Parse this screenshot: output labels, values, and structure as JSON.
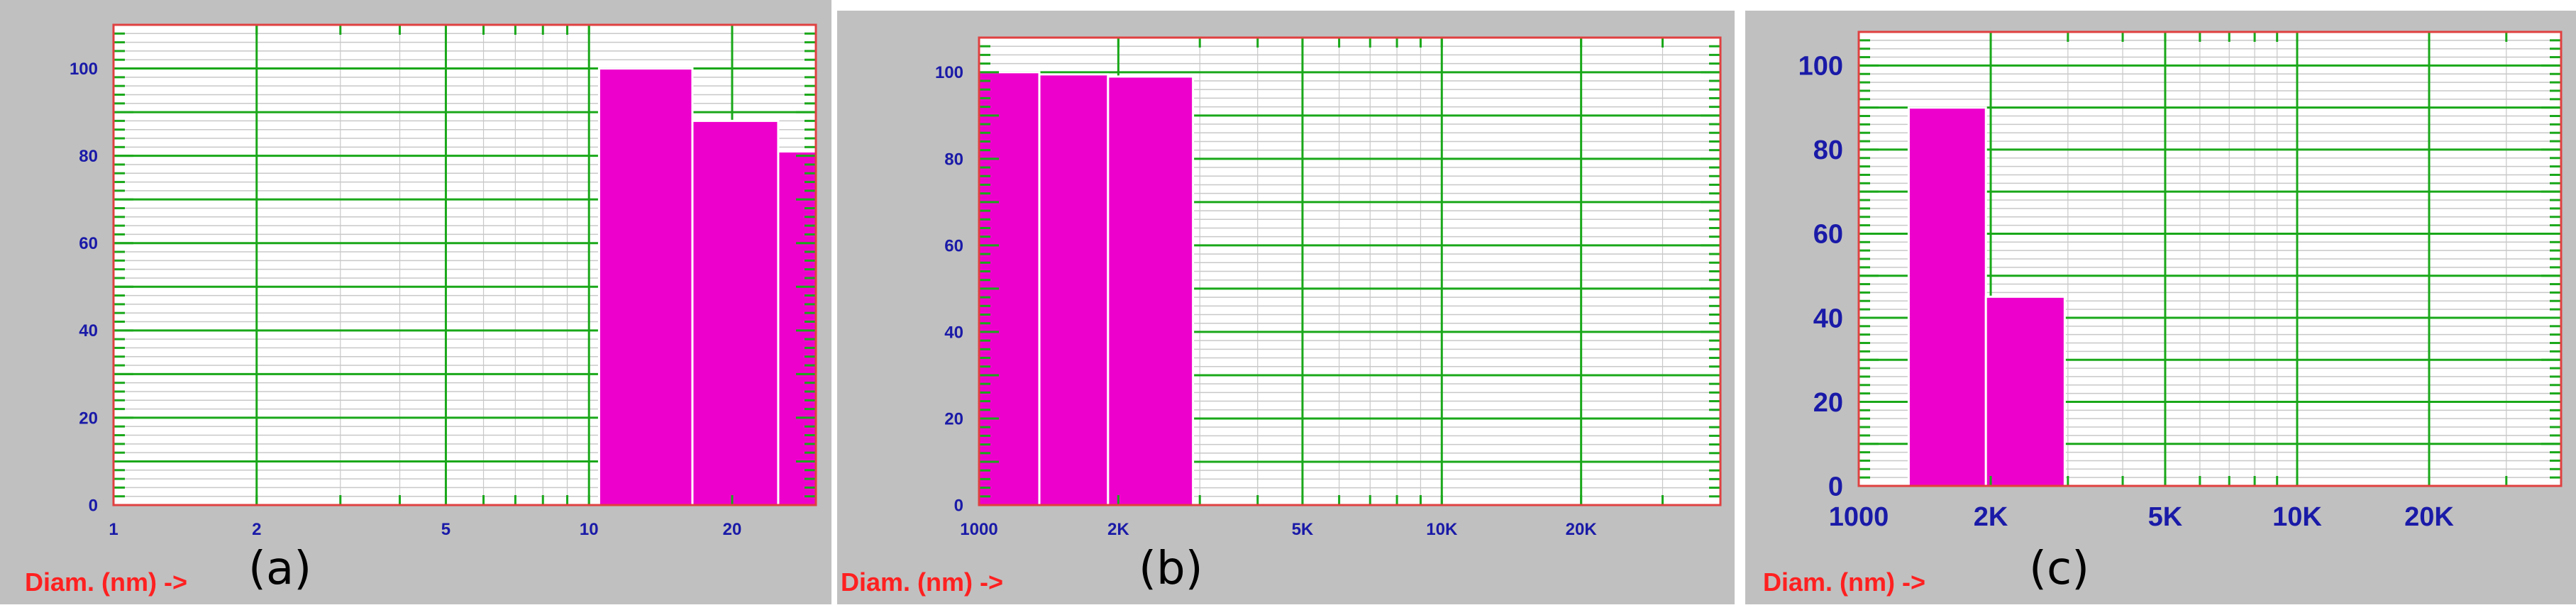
{
  "colors": {
    "panel_bg": "#c0c0c0",
    "plot_bg": "#ffffff",
    "frame": "#e04040",
    "major_grid": "#1aa81a",
    "minor_grid": "#c8c8c8",
    "bar_fill": "#ee00cc",
    "tick_text": "#1a1aa8",
    "axis_name": "#ff2020"
  },
  "chart_data": [
    {
      "type": "bar",
      "panel_label": "(a)",
      "xlabel": "Diam. (nm) ->",
      "x_scale": "log",
      "xlim": [
        1,
        30
      ],
      "ylim": [
        0,
        110
      ],
      "x_ticks": [
        {
          "value": 1,
          "label": "1"
        },
        {
          "value": 2,
          "label": "2"
        },
        {
          "value": 5,
          "label": "5"
        },
        {
          "value": 10,
          "label": "10"
        },
        {
          "value": 20,
          "label": "20"
        }
      ],
      "y_ticks": [
        {
          "value": 0,
          "label": "0"
        },
        {
          "value": 20,
          "label": "20"
        },
        {
          "value": 40,
          "label": "40"
        },
        {
          "value": 60,
          "label": "60"
        },
        {
          "value": 80,
          "label": "80"
        },
        {
          "value": 100,
          "label": "100"
        }
      ],
      "bars": [
        {
          "x0": 10.5,
          "x1": 16.5,
          "value": 100
        },
        {
          "x0": 16.5,
          "x1": 25,
          "value": 88
        },
        {
          "x0": 25,
          "x1": 30,
          "value": 81
        }
      ],
      "grid": true
    },
    {
      "type": "bar",
      "panel_label": "(b)",
      "xlabel": "Diam. (nm) ->",
      "x_scale": "log",
      "xlim": [
        1000,
        40000
      ],
      "ylim": [
        0,
        108
      ],
      "x_ticks": [
        {
          "value": 1000,
          "label": "1000"
        },
        {
          "value": 2000,
          "label": "2K"
        },
        {
          "value": 5000,
          "label": "5K"
        },
        {
          "value": 10000,
          "label": "10K"
        },
        {
          "value": 20000,
          "label": "20K"
        }
      ],
      "y_ticks": [
        {
          "value": 0,
          "label": "0"
        },
        {
          "value": 20,
          "label": "20"
        },
        {
          "value": 40,
          "label": "40"
        },
        {
          "value": 60,
          "label": "60"
        },
        {
          "value": 80,
          "label": "80"
        },
        {
          "value": 100,
          "label": "100"
        }
      ],
      "bars": [
        {
          "x0": 1000,
          "x1": 1350,
          "value": 100
        },
        {
          "x0": 1350,
          "x1": 1900,
          "value": 99.5
        },
        {
          "x0": 1900,
          "x1": 2900,
          "value": 99
        }
      ],
      "grid": true
    },
    {
      "type": "bar",
      "panel_label": "(c)",
      "xlabel": "Diam. (nm) ->",
      "x_scale": "log",
      "xlim": [
        1000,
        40000
      ],
      "ylim": [
        0,
        108
      ],
      "x_ticks": [
        {
          "value": 1000,
          "label": "1000"
        },
        {
          "value": 2000,
          "label": "2K"
        },
        {
          "value": 5000,
          "label": "5K"
        },
        {
          "value": 10000,
          "label": "10K"
        },
        {
          "value": 20000,
          "label": "20K"
        }
      ],
      "y_ticks": [
        {
          "value": 0,
          "label": "0"
        },
        {
          "value": 20,
          "label": "20"
        },
        {
          "value": 40,
          "label": "40"
        },
        {
          "value": 60,
          "label": "60"
        },
        {
          "value": 80,
          "label": "80"
        },
        {
          "value": 100,
          "label": "100"
        }
      ],
      "bars": [
        {
          "x0": 1300,
          "x1": 1950,
          "value": 90
        },
        {
          "x0": 1950,
          "x1": 2950,
          "value": 45
        }
      ],
      "grid": true
    }
  ]
}
